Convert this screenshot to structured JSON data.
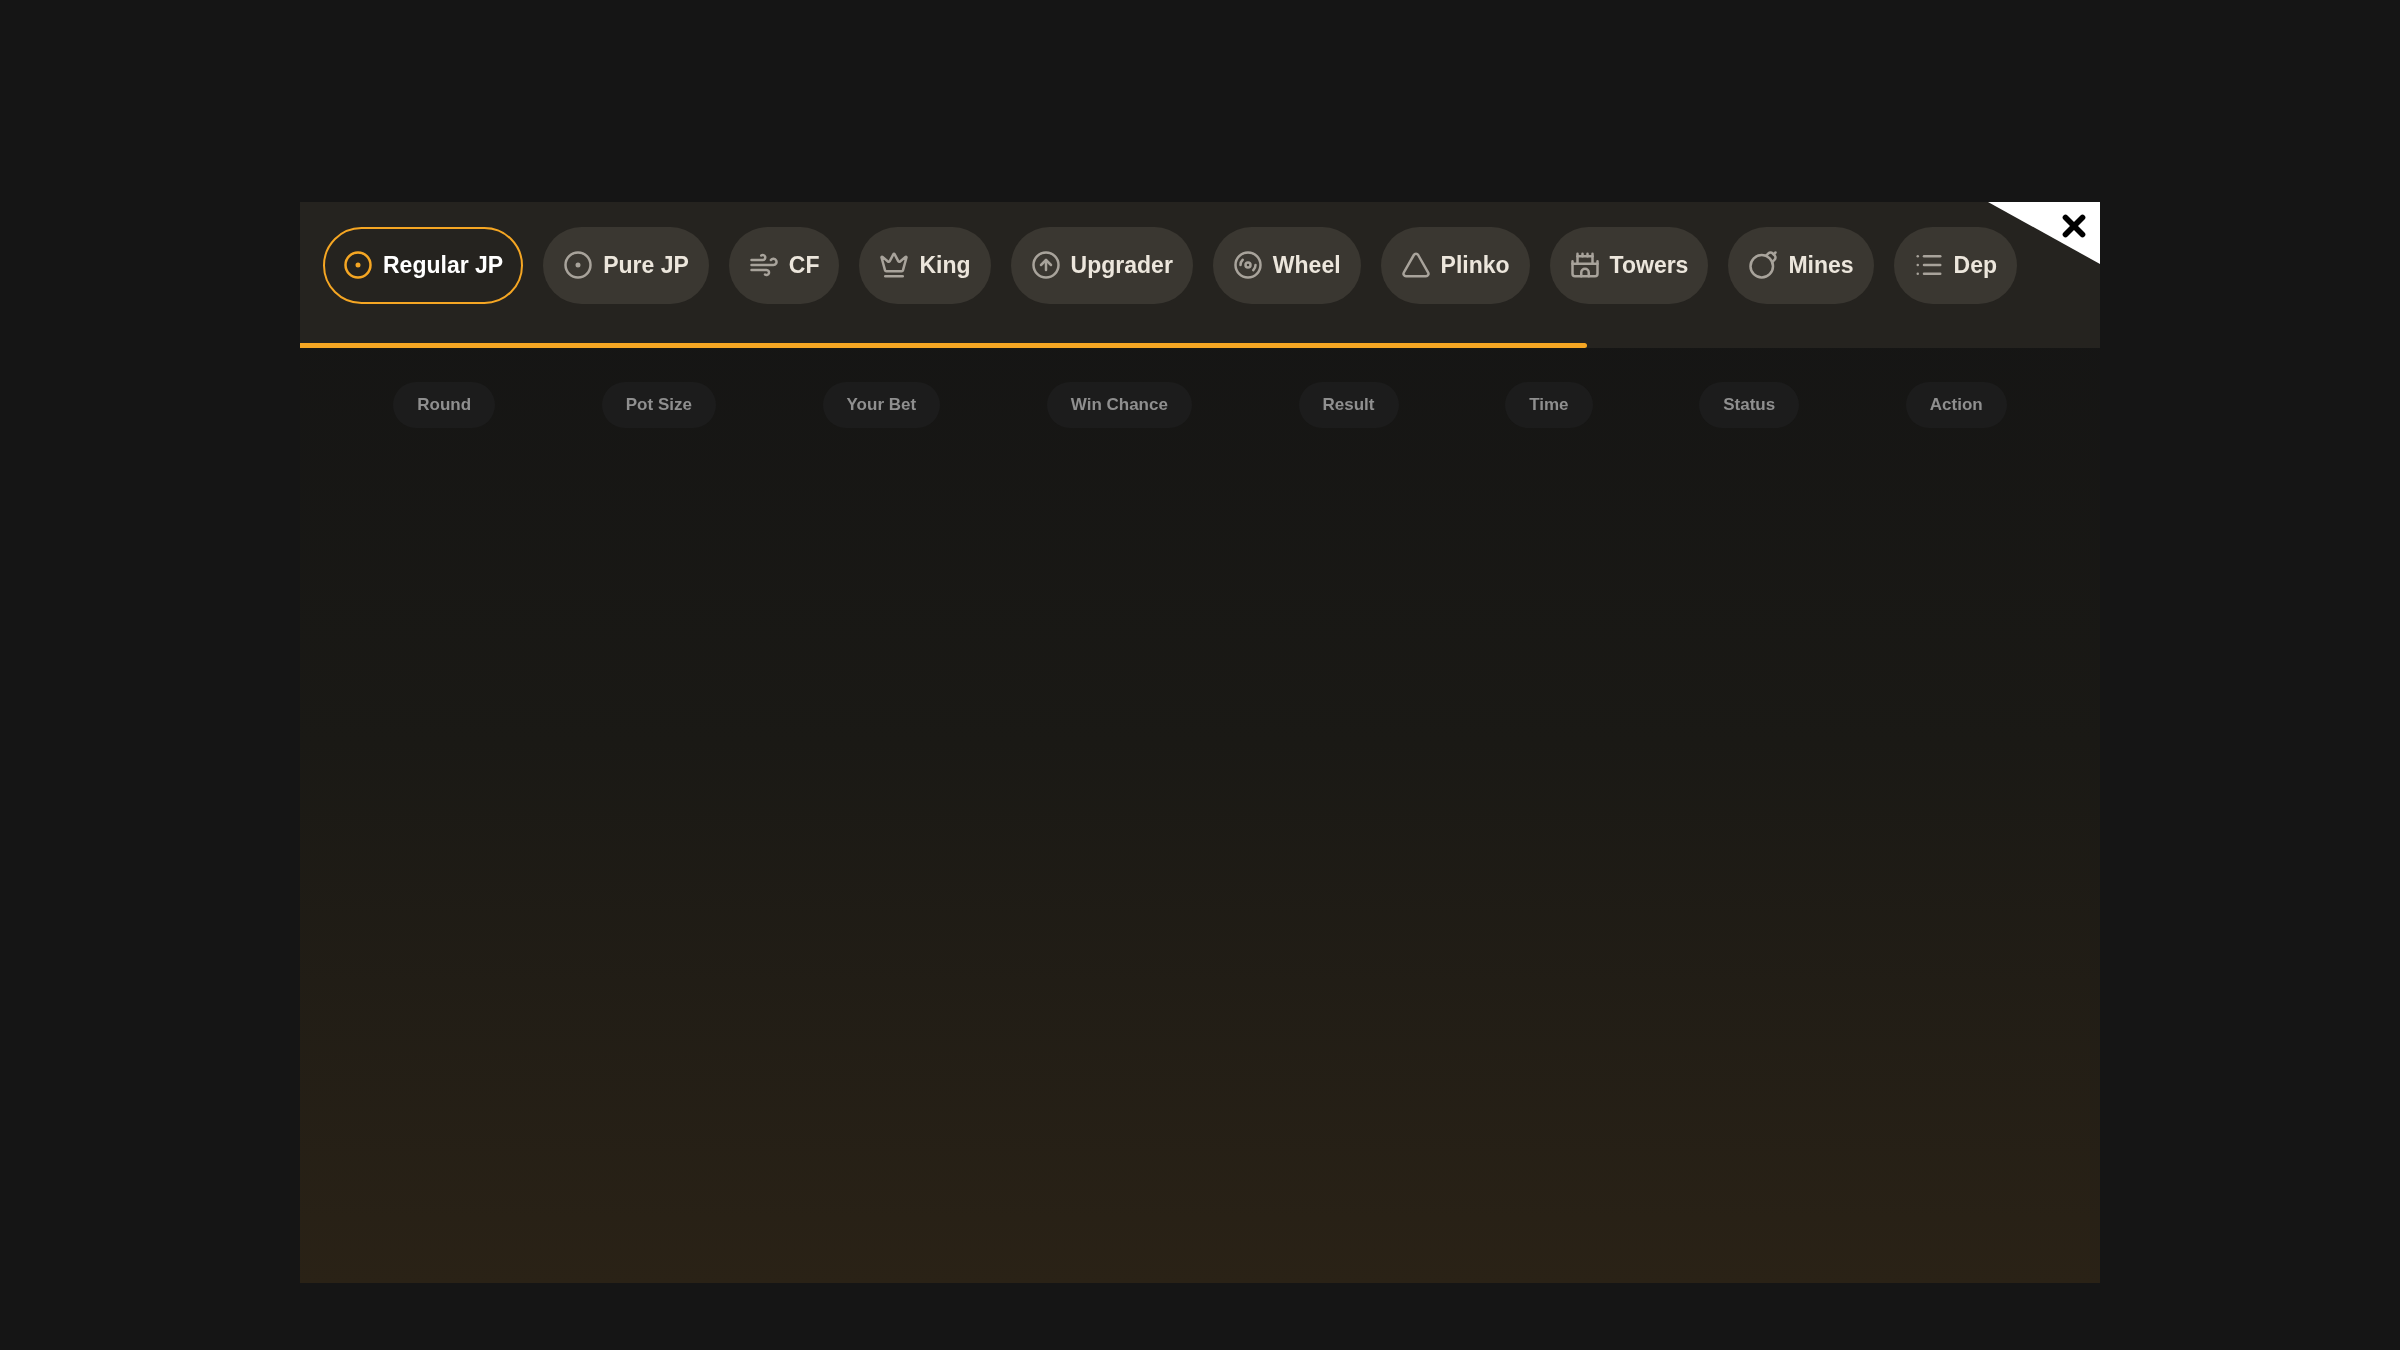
{
  "tabs": [
    {
      "label": "Regular JP",
      "kind": "jackpot",
      "selected": true
    },
    {
      "label": "Pure JP",
      "kind": "jackpot",
      "selected": false
    },
    {
      "label": "CF",
      "kind": "coinflip",
      "selected": false
    },
    {
      "label": "King",
      "kind": "king",
      "selected": false
    },
    {
      "label": "Upgrader",
      "kind": "upgrader",
      "selected": false
    },
    {
      "label": "Wheel",
      "kind": "wheel",
      "selected": false
    },
    {
      "label": "Plinko",
      "kind": "plinko",
      "selected": false
    },
    {
      "label": "Towers",
      "kind": "towers",
      "selected": false
    },
    {
      "label": "Mines",
      "kind": "mines",
      "selected": false
    },
    {
      "label": "Dep",
      "kind": "list",
      "selected": false
    }
  ],
  "table": {
    "columns": [
      "Round",
      "Pot Size",
      "Your Bet",
      "Win Chance",
      "Result",
      "Time",
      "Status",
      "Action"
    ]
  }
}
